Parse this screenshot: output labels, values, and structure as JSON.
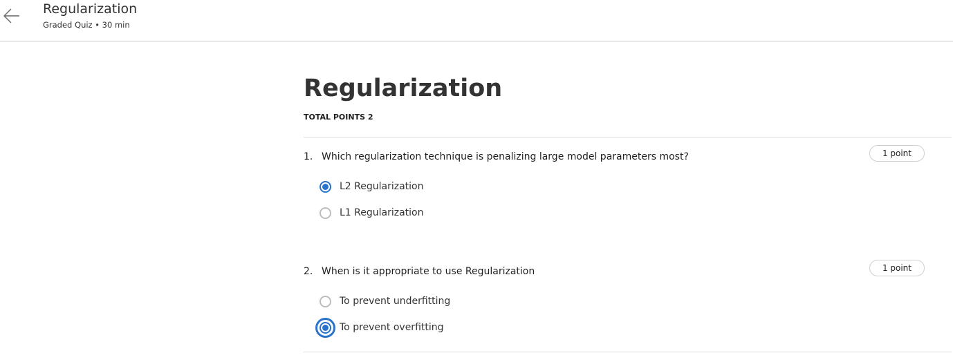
{
  "header": {
    "title": "Regularization",
    "subtitle": "Graded Quiz • 30 min",
    "back_icon": "arrow-left-icon"
  },
  "quiz": {
    "title": "Regularization",
    "total_points": "TOTAL POINTS 2"
  },
  "questions": [
    {
      "number": "1.",
      "text": "Which regularization technique is penalizing large model parameters most?",
      "points": "1 point",
      "options": [
        {
          "label": "L2 Regularization",
          "selected": true
        },
        {
          "label": "L1 Regularization",
          "selected": false
        }
      ]
    },
    {
      "number": "2.",
      "text": "When is it appropriate to use Regularization",
      "points": "1 point",
      "options": [
        {
          "label": "To prevent underfitting",
          "selected": false
        },
        {
          "label": "To prevent overfitting",
          "selected": true,
          "focused": true
        }
      ]
    }
  ],
  "colors": {
    "accent": "#2a73cc"
  }
}
